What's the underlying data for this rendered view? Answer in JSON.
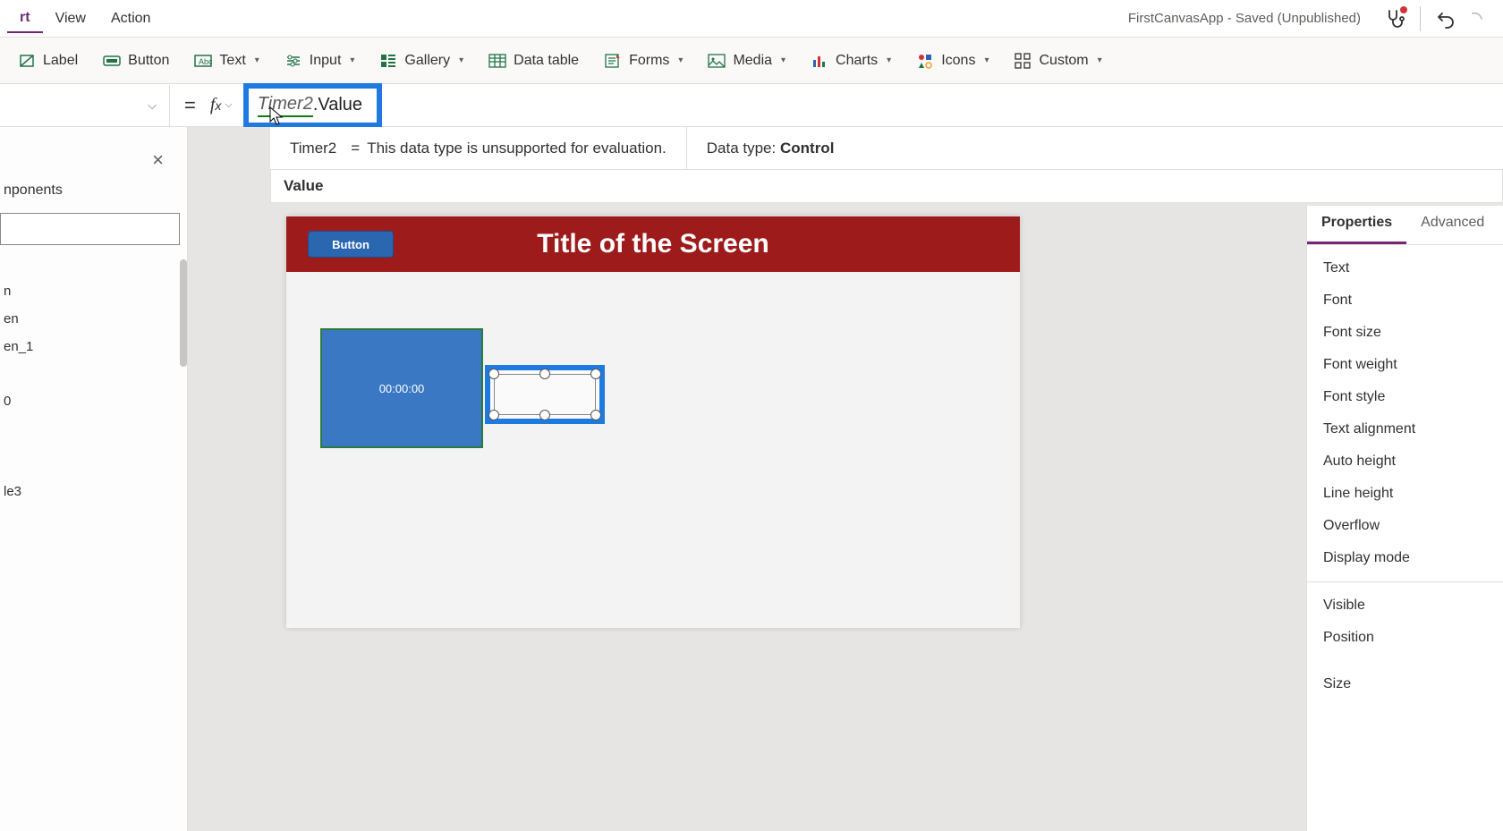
{
  "menu": {
    "items": [
      "rt",
      "View",
      "Action"
    ]
  },
  "app_status": "FirstCanvasApp - Saved (Unpublished)",
  "ribbon": {
    "label": "Label",
    "button": "Button",
    "text": "Text",
    "input": "Input",
    "gallery": "Gallery",
    "datatable": "Data table",
    "forms": "Forms",
    "media": "Media",
    "charts": "Charts",
    "icons": "Icons",
    "custom": "Custom"
  },
  "formula": {
    "token_name": "Timer2",
    "token_rest": ".Value",
    "info_name": "Timer2",
    "info_msg": "This data type is unsupported for evaluation.",
    "datatype_label": "Data type:",
    "datatype_value": "Control",
    "suggestion": "Value"
  },
  "left": {
    "tab": "nponents",
    "close": "×",
    "tree": [
      "n",
      "en",
      "en_1",
      "0",
      "le3"
    ]
  },
  "canvas": {
    "title": "Title of the Screen",
    "button": "Button",
    "timer": "00:00:00"
  },
  "props": {
    "tabs": {
      "properties": "Properties",
      "advanced": "Advanced"
    },
    "items_a": [
      "Text",
      "Font",
      "Font size",
      "Font weight",
      "Font style",
      "Text alignment",
      "Auto height",
      "Line height",
      "Overflow",
      "Display mode"
    ],
    "items_b": [
      "Visible",
      "Position",
      "Size"
    ]
  }
}
